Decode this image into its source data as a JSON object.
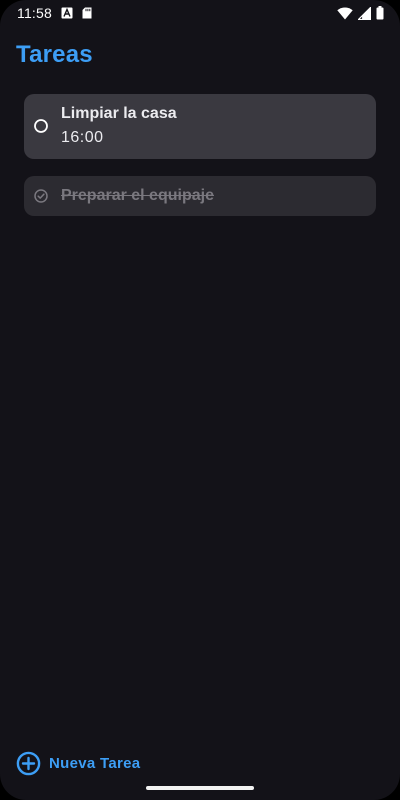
{
  "status_bar": {
    "time": "11:58",
    "left_icons": [
      "font-a-icon",
      "sd-card-icon"
    ],
    "right_icons": [
      "wifi-icon",
      "cell-signal-icon",
      "battery-icon"
    ]
  },
  "header": {
    "title": "Tareas"
  },
  "tasks": [
    {
      "title": "Limpiar la casa",
      "time": "16:00",
      "completed": false,
      "icon": "radio-unchecked-icon"
    },
    {
      "title": "Preparar el equipaje",
      "completed": true,
      "icon": "check-circle-icon"
    }
  ],
  "actions": {
    "new_task_label": "Nueva Tarea",
    "new_task_icon": "plus-circle-icon"
  },
  "colors": {
    "background": "#131218",
    "accent": "#3d9ef5",
    "card_active": "#3a3940",
    "card_done": "#2c2b31",
    "text_primary": "#ececf0",
    "text_done": "#7a787f"
  }
}
